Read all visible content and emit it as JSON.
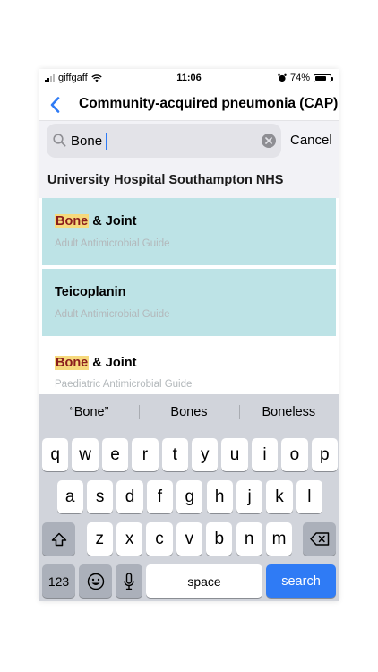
{
  "status_bar": {
    "carrier": "giffgaff",
    "time": "11:06",
    "battery": "74%",
    "battery_level": 0.74
  },
  "nav": {
    "title": "Community-acquired pneumonia (CAP)"
  },
  "search": {
    "value": "Bone",
    "cancel_label": "Cancel"
  },
  "section": {
    "title": "University Hospital Southampton NHS"
  },
  "results": [
    {
      "highlight": "Bone",
      "title_rest": " & Joint",
      "subtitle": "Adult Antimicrobial Guide"
    },
    {
      "highlight": "",
      "title_rest": "Teicoplanin",
      "subtitle": "Adult Antimicrobial Guide"
    },
    {
      "highlight": "Bone",
      "title_rest": " & Joint",
      "subtitle": "Paediatric Antimicrobial Guide"
    }
  ],
  "keyboard": {
    "suggestions": [
      "“Bone”",
      "Bones",
      "Boneless"
    ],
    "row1": [
      "q",
      "w",
      "e",
      "r",
      "t",
      "y",
      "u",
      "i",
      "o",
      "p"
    ],
    "row2": [
      "a",
      "s",
      "d",
      "f",
      "g",
      "h",
      "j",
      "k",
      "l"
    ],
    "row3": [
      "z",
      "x",
      "c",
      "v",
      "b",
      "n",
      "m"
    ],
    "numbers_label": "123",
    "space_label": "space",
    "search_label": "search"
  },
  "colors": {
    "accent": "#2f7bf5",
    "result_highlight": "#bde3e6",
    "match_highlight": "#f6d97c"
  }
}
